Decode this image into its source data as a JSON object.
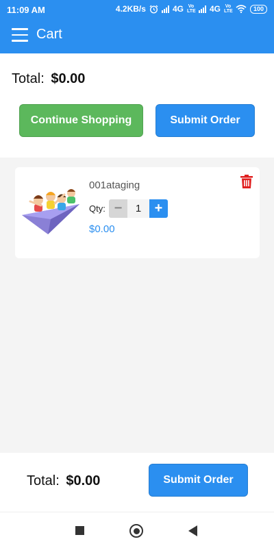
{
  "status_bar": {
    "time": "11:09 AM",
    "speed": "4.2KB/s",
    "network_1": "4G",
    "network_2": "4G",
    "volte_1": "Vo LTE",
    "volte_2": "Vo LTE",
    "battery": "100"
  },
  "app_bar": {
    "title": "Cart"
  },
  "summary": {
    "total_label": "Total:",
    "total_value": "$0.00",
    "continue_label": "Continue Shopping",
    "submit_label": "Submit Order"
  },
  "cart_items": [
    {
      "name": "001ataging",
      "qty_label": "Qty:",
      "qty": "1",
      "price": "$0.00"
    }
  ],
  "footer": {
    "total_label": "Total:",
    "total_value": "$0.00",
    "submit_label": "Submit Order"
  },
  "colors": {
    "primary": "#2b8ff0",
    "success": "#5cb85c",
    "danger": "#e02020"
  }
}
